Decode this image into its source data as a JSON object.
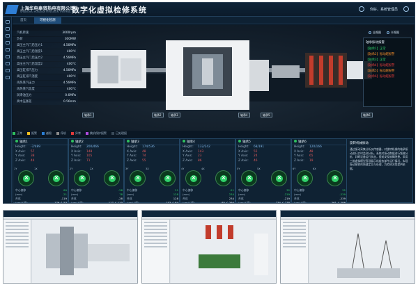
{
  "header": {
    "company_cn": "上海华电奉贤热电有限公司",
    "company_en": "SHANGHAI HUADIAN FENGXIAN THERMAL POWER CO.,LTD",
    "system_title": "数字化虚拟检修系统",
    "user": "你好，系统管理员"
  },
  "tabs": [
    {
      "label": "首页"
    },
    {
      "label": "可视化检测"
    }
  ],
  "view_controls": {
    "options": [
      "全视图",
      "半视图"
    ]
  },
  "params": [
    {
      "label": "汽机转速",
      "value": "3000rpm"
    },
    {
      "label": "负荷",
      "value": "300MW"
    },
    {
      "label": "高压主汽门后压力1",
      "value": "4.56MPa"
    },
    {
      "label": "高压主汽门后温度1",
      "value": "400℃"
    },
    {
      "label": "高压主汽门后压力2",
      "value": "4.56MPa"
    },
    {
      "label": "高压主汽门后温度2",
      "value": "400℃"
    },
    {
      "label": "高压缸排汽压力",
      "value": "4.56MPa"
    },
    {
      "label": "高压缸排汽温度",
      "value": "400℃"
    },
    {
      "label": "再热蒸汽压力",
      "value": "4.56MPa"
    },
    {
      "label": "再热蒸汽温度",
      "value": "400℃"
    },
    {
      "label": "润滑油压力",
      "value": "0.6MPa"
    },
    {
      "label": "高中压胀差",
      "value": "0.56mm"
    }
  ],
  "alarms": {
    "title": "轴承振动报警",
    "items": [
      {
        "text": "【轴承1】正常",
        "color": "#2fd16a"
      },
      {
        "text": "【轴承2】振动越报警",
        "color": "#f08a2a"
      },
      {
        "text": "【轴承3】正常",
        "color": "#2fd16a"
      },
      {
        "text": "【轴承4】振动越报警",
        "color": "#e03b3b"
      },
      {
        "text": "【轴承5】振动越报警",
        "color": "#f08a2a"
      },
      {
        "text": "【轴承6】振动越报警",
        "color": "#e03b3b"
      }
    ]
  },
  "bearing_labels": [
    "轴承1",
    "轴承2",
    "轴承3",
    "轴承4",
    "轴承5",
    "轴承6"
  ],
  "legend": [
    {
      "label": "正常",
      "color": "#2fbf5f"
    },
    {
      "label": "报警",
      "color": "#f0c020"
    },
    {
      "label": "越限",
      "color": "#2a7fd6"
    },
    {
      "label": "停机",
      "color": "#8c8c8c"
    },
    {
      "label": "异常",
      "color": "#e03b3b"
    },
    {
      "label": "跳机保护报警",
      "color": "#b04be0"
    },
    {
      "label": "已处理报",
      "color": "#3a4b5a"
    }
  ],
  "cards": [
    {
      "title": "轴承1",
      "rows": [
        [
          "Height:",
          "-7/489"
        ],
        [
          "X Axis:",
          "57"
        ],
        [
          "Y Axis:",
          "38"
        ],
        [
          "Z Axis:",
          "44"
        ]
      ],
      "dial_labels": [
        "1Y",
        "1X"
      ],
      "center_vals": [
        "89",
        "-21"
      ],
      "bottom_a": "-119",
      "bottom_b": "179 ∠ 53"
    },
    {
      "title": "轴承2",
      "rows": [
        [
          "Height:",
          "200/466"
        ],
        [
          "X Axis:",
          "148"
        ],
        [
          "Y Axis:",
          "105"
        ],
        [
          "Z Axis:",
          "71"
        ]
      ],
      "dial_labels": [
        "2Y",
        "2X"
      ],
      "center_vals": [
        "-28",
        "78"
      ],
      "bottom_a": "-28",
      "bottom_b": "117 ∠ 110"
    },
    {
      "title": "轴承3",
      "rows": [
        [
          "Height:",
          "174/536"
        ],
        [
          "X Axis:",
          "48"
        ],
        [
          "Y Axis:",
          "74"
        ],
        [
          "Z Axis:",
          "55"
        ]
      ],
      "dial_labels": [
        "3Y",
        "3X"
      ],
      "center_vals": [
        "21",
        "128"
      ],
      "bottom_a": "128",
      "bottom_b": "153 ∠ 84"
    },
    {
      "title": "轴承4",
      "rows": [
        [
          "Height:",
          "132/242"
        ],
        [
          "X Axis:",
          "143"
        ],
        [
          "Y Axis:",
          "23"
        ],
        [
          "Z Axis:",
          "86"
        ]
      ],
      "dial_labels": [
        "4Y",
        "4X"
      ],
      "center_vals": [
        "-21",
        "234"
      ],
      "bottom_a": "234",
      "bottom_b": "85 ∠ 294"
    },
    {
      "title": "轴承5",
      "rows": [
        [
          "Height:",
          "68/191"
        ],
        [
          "X Axis:",
          "55"
        ],
        [
          "Y Axis:",
          "24"
        ],
        [
          "Z Axis:",
          "46"
        ]
      ],
      "dial_labels": [
        "5Y",
        "5X"
      ],
      "center_vals": [
        "32",
        "-219"
      ],
      "bottom_a": "-219",
      "bottom_b": "234 ∠ 278"
    },
    {
      "title": "轴承6",
      "rows": [
        [
          "Height:",
          "120/166"
        ],
        [
          "X Axis:",
          "48"
        ],
        [
          "Y Axis:",
          "65"
        ],
        [
          "Z Axis:",
          "19"
        ]
      ],
      "dial_labels": [
        "6Y",
        "6X"
      ],
      "center_vals": [
        "32",
        "-239"
      ],
      "bottom_a": "-239",
      "bottom_b": "261 ∠ 286"
    }
  ],
  "card_labels": {
    "center": "中心偏移",
    "unit": "(mm)",
    "combined": "合成",
    "combined_unit": "(um/∠度)"
  },
  "info_panel": {
    "title": "旋转机械振动",
    "text": "通过振动采集分析仪传感器，对旋转机械的轴承振动进行实时监测分析。系统对振动数据进行频谱分析，判断设备运行状态，提前发现故障隐患。采用三维虚拟模型直观展示机组各部件运行情况，实现振动报警的快速定位与处理，为检修决策提供依据。"
  }
}
